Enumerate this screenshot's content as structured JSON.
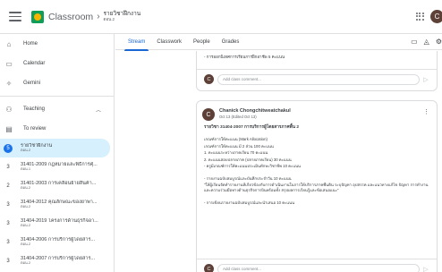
{
  "header": {
    "app_name": "Classroom",
    "breadcrumb_title": "รายวิชาฝึกงาน",
    "breadcrumb_sub": "ตอน.2",
    "avatar_letter": "C"
  },
  "sidebar": {
    "home": "Home",
    "calendar": "Calendar",
    "gemini": "Gemini",
    "teaching": "Teaching",
    "to_review": "To review",
    "classes": [
      {
        "num": "5",
        "name": "รายวิชาฝึกงาน",
        "sub": "ตอน.2",
        "active": true
      },
      {
        "num": "3",
        "name": "31401-2009 กฎหมายและพิธีการศุ...",
        "sub": "ตอน.1"
      },
      {
        "num": "2",
        "name": "31401-2003 การเคลื่อนย้ายสินค้า...",
        "sub": "ตอน.2"
      },
      {
        "num": "3",
        "name": "31404-2012 คุณลักษณะของยาพา...",
        "sub": "ตอน.2"
      },
      {
        "num": "3",
        "name": "31404-2019 โครงการด้านธุรกิจอา...",
        "sub": "ตอน.2"
      },
      {
        "num": "3",
        "name": "31404-2006 การบริการผู้โดยสาร...",
        "sub": "ตอน.2"
      },
      {
        "num": "3",
        "name": "31404-2007 การบริการผู้โดยสาร...",
        "sub": "ตอน.2"
      }
    ]
  },
  "tabs": {
    "stream": "Stream",
    "classwork": "Classwork",
    "people": "People",
    "grades": "Grades"
  },
  "stream": {
    "card1_text": "- การออกนิเทศการเรียนการฝึกอาชีพ 5 คะแนน",
    "comment_placeholder": "Add class comment...",
    "post": {
      "author": "Chanick Chongchitweatchakul",
      "date": "Oct 13 (Edited Oct 13)",
      "title": "รายวิชา 31404-2007 การบริการผู้โดยสารภาคพื้น 2",
      "lines": [
        "เกณฑ์การให้คะแนน (Mark Allocation)",
        "เกณฑ์การให้คะแนน มี 2 ส่วน 100 คะแนน",
        "1. คะแนนระหว่างภาคเรียน 70 คะแนน",
        "2. คะแนนสอบปลายภาค (ปลายภาคเรียน) 30 คะแนน",
        "- ครูมีเกณฑ์การให้คะแนนประเมินทักษะวิชาชีพ 10 คะแนน",
        "- รายงานฉบับสมบูรณ์และบันทึกประจำวัน 10 คะแนน",
        "\"ให้ผู้เรียนจัดทำรายงานที่เกี่ยวข้องกับการดำเนินงานในการให้บริการภาคพื้นดิน ระบุปัญหา อุปสรรค และแนวทางแก้ไข ปัญหา การทำงานและความร่วมมือทางด้านธุรกิจการบินพร้อมทั้ง สรุปผลการเรียนรู้และข้อเสนอแนะ\"",
        "- การเขียนรายงานฉบับสมบูรณ์และนำเสนอ 10 คะแนน"
      ]
    }
  }
}
